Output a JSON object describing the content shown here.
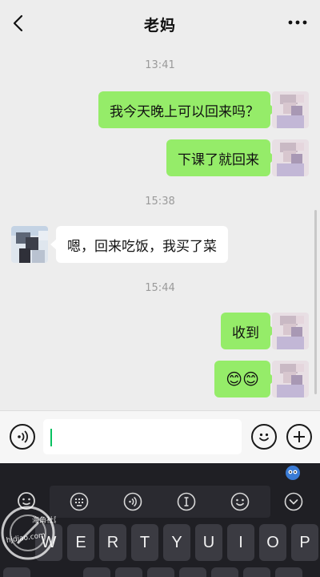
{
  "header": {
    "title": "老妈"
  },
  "messages": [
    {
      "type": "time",
      "text": "13:41"
    },
    {
      "type": "msg",
      "from": "me",
      "text": "我今天晚上可以回来吗？"
    },
    {
      "type": "msg",
      "from": "me",
      "text": "下课了就回来"
    },
    {
      "type": "time",
      "text": "15:38"
    },
    {
      "type": "msg",
      "from": "other",
      "text": "嗯，回来吃饭，我买了菜"
    },
    {
      "type": "time",
      "text": "15:44"
    },
    {
      "type": "msg",
      "from": "me",
      "text": "收到"
    },
    {
      "type": "msg",
      "from": "me",
      "text": "😊😊"
    }
  ],
  "input": {
    "value": ""
  },
  "keyboard": {
    "keys": [
      "W",
      "E",
      "R",
      "T",
      "Y",
      "U",
      "I",
      "O",
      "P"
    ]
  },
  "watermark": {
    "top_text": "海角社区",
    "bottom_text": "hjdjao.com"
  },
  "colors": {
    "my_bubble": "#95ec69",
    "other_bubble": "#ffffff",
    "background": "#ededed",
    "cursor": "#07c160",
    "keyboard": "#1f1f24"
  }
}
